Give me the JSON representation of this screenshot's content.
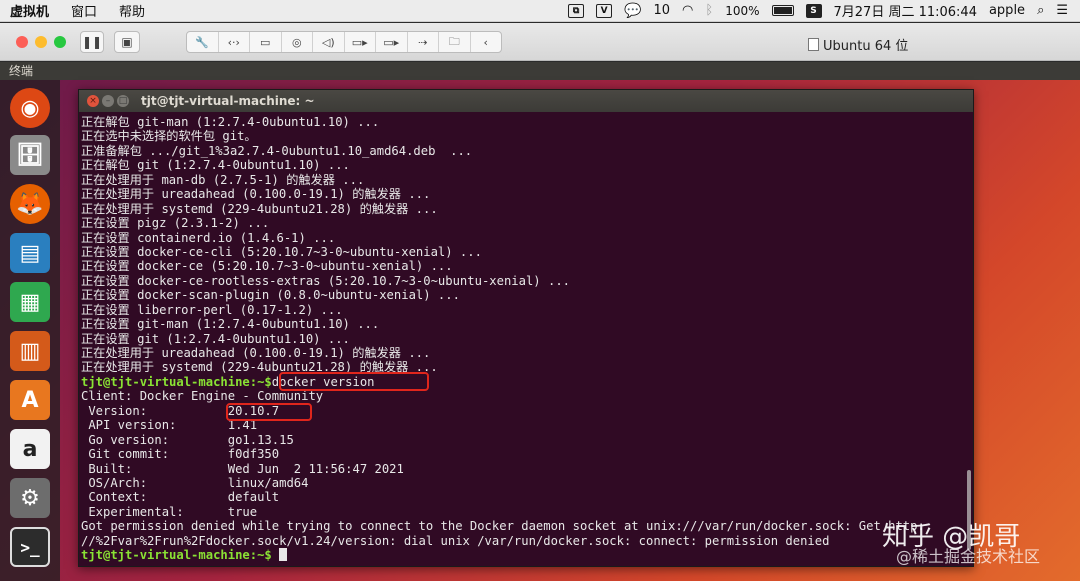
{
  "mac_menu": {
    "app": "虚拟机",
    "items": [
      "窗口",
      "帮助"
    ],
    "wechat_count": "10",
    "battery": "100%",
    "datetime": "7月27日 周二  11:06:44",
    "user": "apple"
  },
  "vm": {
    "title": "Ubuntu 64 位"
  },
  "ubuntu_panel": {
    "app_title": "终端"
  },
  "terminal": {
    "title": "tjt@tjt-virtual-machine: ~",
    "lines": [
      "正在解包 git-man (1:2.7.4-0ubuntu1.10) ...",
      "正在选中未选择的软件包 git。",
      "正准备解包 .../git_1%3a2.7.4-0ubuntu1.10_amd64.deb  ...",
      "正在解包 git (1:2.7.4-0ubuntu1.10) ...",
      "正在处理用于 man-db (2.7.5-1) 的触发器 ...",
      "正在处理用于 ureadahead (0.100.0-19.1) 的触发器 ...",
      "正在处理用于 systemd (229-4ubuntu21.28) 的触发器 ...",
      "正在设置 pigz (2.3.1-2) ...",
      "正在设置 containerd.io (1.4.6-1) ...",
      "正在设置 docker-ce-cli (5:20.10.7~3-0~ubuntu-xenial) ...",
      "正在设置 docker-ce (5:20.10.7~3-0~ubuntu-xenial) ...",
      "正在设置 docker-ce-rootless-extras (5:20.10.7~3-0~ubuntu-xenial) ...",
      "正在设置 docker-scan-plugin (0.8.0~ubuntu-xenial) ...",
      "正在设置 liberror-perl (0.17-1.2) ...",
      "正在设置 git-man (1:2.7.4-0ubuntu1.10) ...",
      "正在设置 git (1:2.7.4-0ubuntu1.10) ...",
      "正在处理用于 ureadahead (0.100.0-19.1) 的触发器 ...",
      "正在处理用于 systemd (229-4ubuntu21.28) 的触发器 ..."
    ],
    "prompt": "tjt@tjt-virtual-machine:~$",
    "command": "docker version",
    "output": [
      "Client: Docker Engine - Community",
      " Version:           20.10.7",
      " API version:       1.41",
      " Go version:        go1.13.15",
      " Git commit:        f0df350",
      " Built:             Wed Jun  2 11:56:47 2021",
      " OS/Arch:           linux/amd64",
      " Context:           default",
      " Experimental:      true",
      "Got permission denied while trying to connect to the Docker daemon socket at unix:///var/run/docker.sock: Get http:",
      "//%2Fvar%2Frun%2Fdocker.sock/v1.24/version: dial unix /var/run/docker.sock: connect: permission denied"
    ]
  },
  "watermark": {
    "primary": "知乎 @凯哥",
    "secondary": "@稀土掘金技术社区"
  },
  "colors": {
    "terminal_bg": "#300a24",
    "prompt": "#8ae234",
    "highlight_box": "#e0261c"
  },
  "launcher_icons": [
    "ubuntu-dash-icon",
    "files-icon",
    "firefox-icon",
    "writer-icon",
    "calc-icon",
    "impress-icon",
    "software-center-icon",
    "amazon-icon",
    "settings-icon",
    "terminal-icon"
  ]
}
